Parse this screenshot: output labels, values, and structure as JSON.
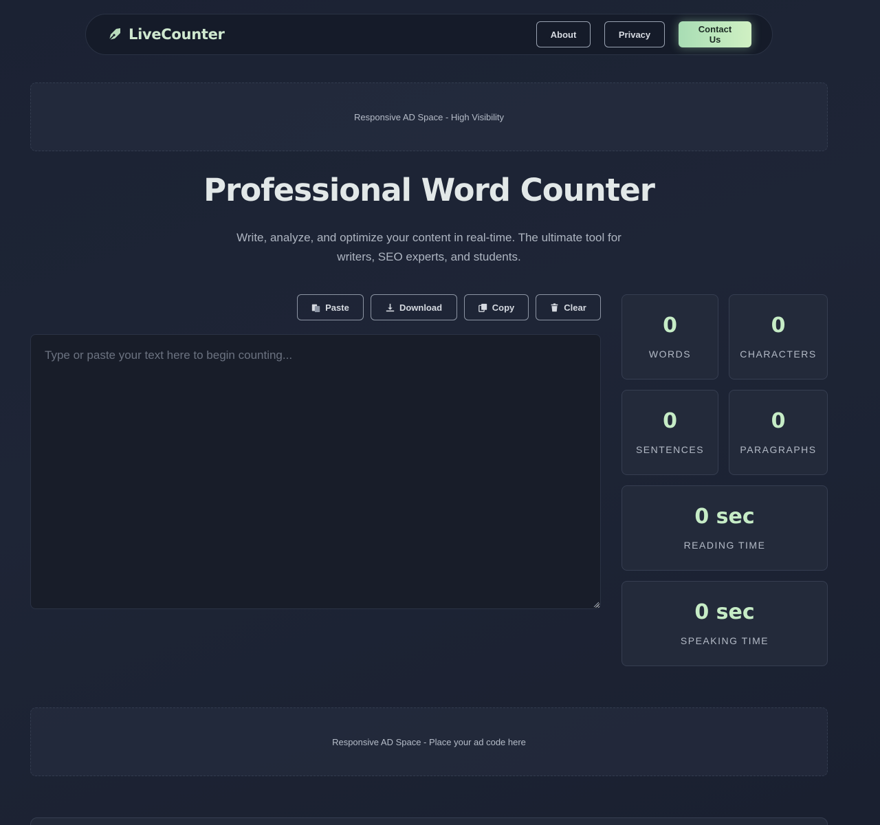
{
  "brand": {
    "name": "LiveCounter",
    "icon": "pen-nib-icon"
  },
  "nav": {
    "about": "About",
    "privacy": "Privacy",
    "contact": "Contact Us"
  },
  "ads": {
    "top": "Responsive AD Space - High Visibility",
    "bottom": "Responsive AD Space - Place your ad code here"
  },
  "hero": {
    "title": "Professional Word Counter",
    "subtitle": "Write, analyze, and optimize your content in real-time. The ultimate tool for writers, SEO experts, and students."
  },
  "toolbar": {
    "paste": "Paste",
    "download": "Download",
    "copy": "Copy",
    "clear": "Clear"
  },
  "editor": {
    "value": "",
    "placeholder": "Type or paste your text here to begin counting..."
  },
  "stats": {
    "words": {
      "value": "0",
      "label": "WORDS"
    },
    "characters": {
      "value": "0",
      "label": "CHARACTERS"
    },
    "sentences": {
      "value": "0",
      "label": "SENTENCES"
    },
    "paragraphs": {
      "value": "0",
      "label": "PARAGRAPHS"
    },
    "reading_time": {
      "value": "0 sec",
      "label": "READING TIME"
    },
    "speaking_time": {
      "value": "0 sec",
      "label": "SPEAKING TIME"
    }
  },
  "colors": {
    "accent": "#c6ecc6",
    "accent_gradient_start": "#a8ddb4",
    "accent_gradient_end": "#d0f0c3",
    "background": "#1b2233"
  }
}
